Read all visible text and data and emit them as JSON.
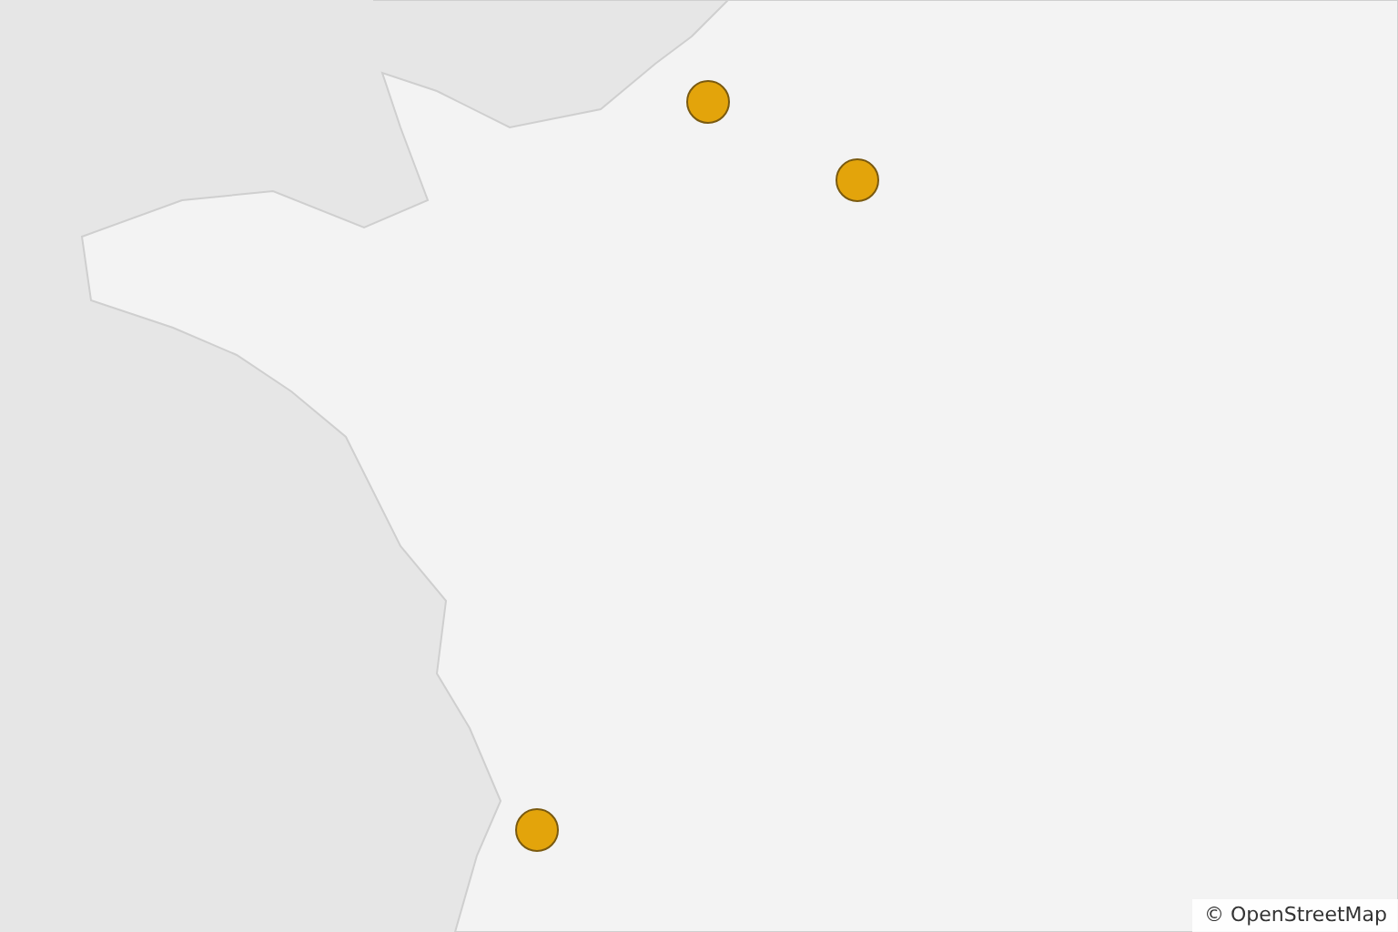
{
  "map": {
    "attribution": "© OpenStreetMap",
    "markers": [
      {
        "kind": "circle"
      },
      {
        "kind": "circle"
      },
      {
        "kind": "circle"
      }
    ]
  }
}
